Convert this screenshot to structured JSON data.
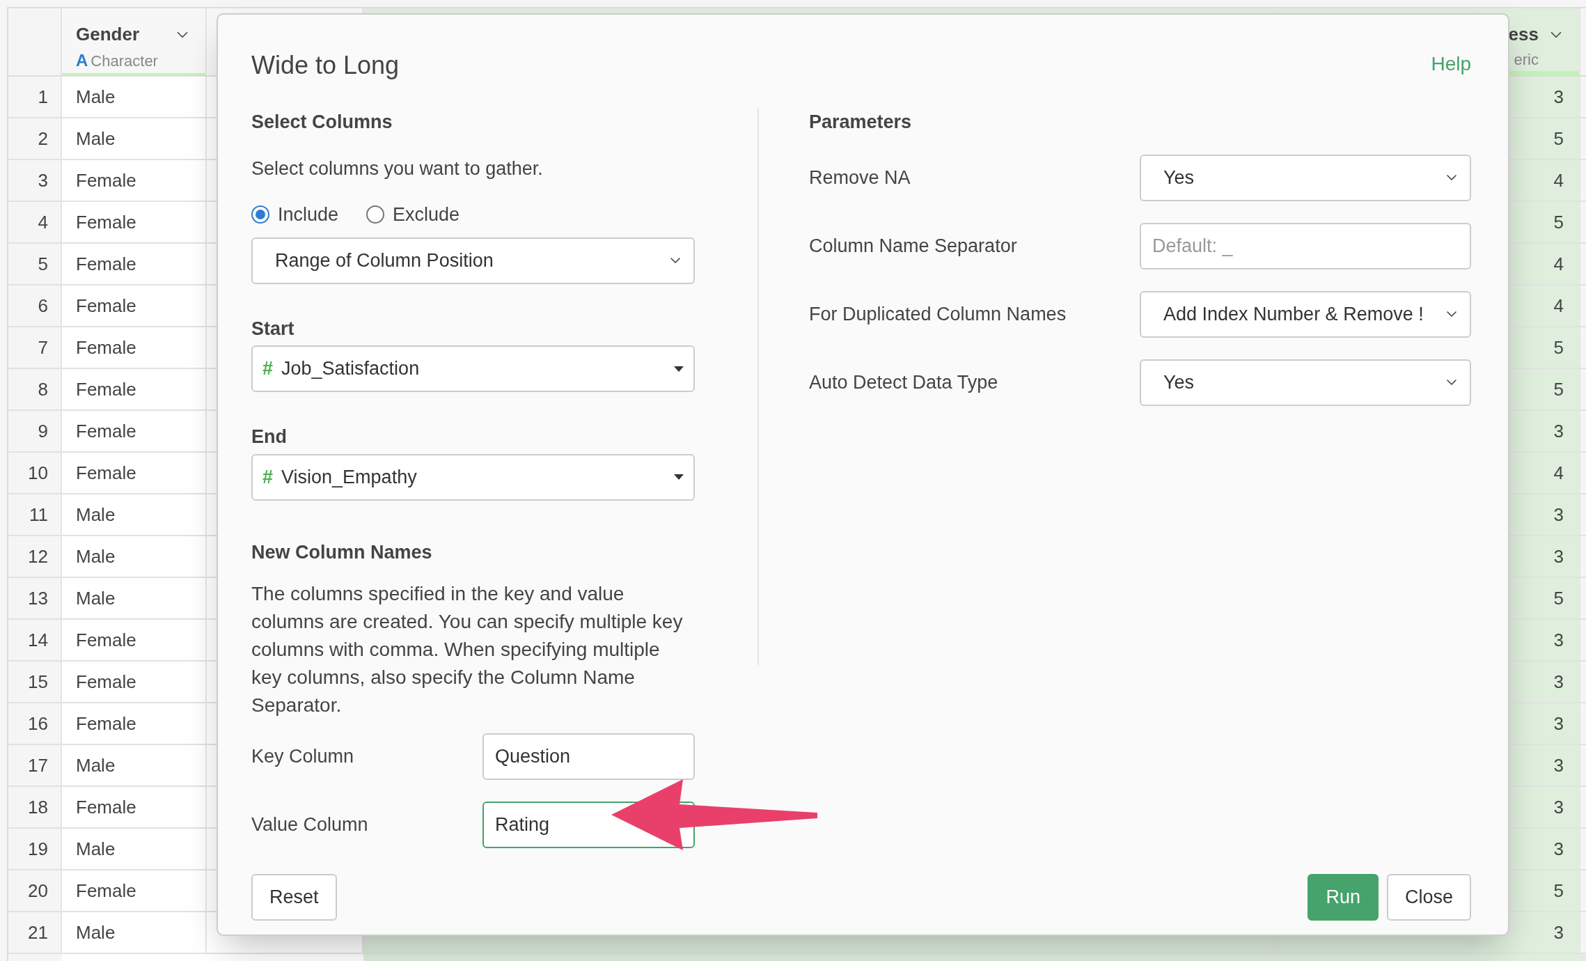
{
  "table": {
    "columns": [
      {
        "name": "Gender",
        "type_icon": "A",
        "type": "Character"
      },
      {
        "name": "ess",
        "type": "eric"
      }
    ],
    "rows": [
      {
        "index": "1",
        "gender": "Male",
        "last": "3"
      },
      {
        "index": "2",
        "gender": "Male",
        "last": "5"
      },
      {
        "index": "3",
        "gender": "Female",
        "last": "4"
      },
      {
        "index": "4",
        "gender": "Female",
        "last": "5"
      },
      {
        "index": "5",
        "gender": "Female",
        "last": "4"
      },
      {
        "index": "6",
        "gender": "Female",
        "last": "4"
      },
      {
        "index": "7",
        "gender": "Female",
        "last": "5"
      },
      {
        "index": "8",
        "gender": "Female",
        "last": "5"
      },
      {
        "index": "9",
        "gender": "Female",
        "last": "3"
      },
      {
        "index": "10",
        "gender": "Female",
        "last": "4"
      },
      {
        "index": "11",
        "gender": "Male",
        "last": "3"
      },
      {
        "index": "12",
        "gender": "Male",
        "last": "3"
      },
      {
        "index": "13",
        "gender": "Male",
        "last": "5"
      },
      {
        "index": "14",
        "gender": "Female",
        "last": "3"
      },
      {
        "index": "15",
        "gender": "Female",
        "last": "3"
      },
      {
        "index": "16",
        "gender": "Female",
        "last": "3"
      },
      {
        "index": "17",
        "gender": "Male",
        "last": "3"
      },
      {
        "index": "18",
        "gender": "Female",
        "last": "3"
      },
      {
        "index": "19",
        "gender": "Male",
        "last": "3"
      },
      {
        "index": "20",
        "gender": "Female",
        "last": "5"
      },
      {
        "index": "21",
        "gender": "Male",
        "last": "3"
      }
    ]
  },
  "dialog": {
    "title": "Wide to Long",
    "help": "Help",
    "select_columns": {
      "heading": "Select Columns",
      "description": "Select columns you want to gather.",
      "modes": [
        {
          "label": "Include",
          "selected": true
        },
        {
          "label": "Exclude",
          "selected": false
        }
      ],
      "method": "Range of Column Position",
      "start": {
        "label": "Start",
        "type_icon": "#",
        "value": "Job_Satisfaction"
      },
      "end": {
        "label": "End",
        "type_icon": "#",
        "value": "Vision_Empathy"
      }
    },
    "new_column_names": {
      "heading": "New Column Names",
      "description": "The columns specified in the key and value columns are created. You can specify multiple key columns with comma. When specifying multiple key columns, also specify the Column Name Separator.",
      "fields": [
        {
          "label": "Key Column",
          "value": "Question",
          "focused": false
        },
        {
          "label": "Value Column",
          "value": "Rating",
          "focused": true
        }
      ]
    },
    "parameters": {
      "heading": "Parameters",
      "rows": [
        {
          "label": "Remove NA",
          "kind": "select",
          "value": "Yes"
        },
        {
          "label": "Column Name Separator",
          "kind": "input",
          "placeholder": "Default: _"
        },
        {
          "label": "For Duplicated Column Names",
          "kind": "select",
          "value": "Add Index Number & Remove !"
        },
        {
          "label": "Auto Detect Data Type",
          "kind": "select",
          "value": "Yes"
        }
      ]
    },
    "buttons": [
      {
        "label": "Reset",
        "kind": "default"
      },
      {
        "label": "Run",
        "kind": "primary"
      },
      {
        "label": "Close",
        "kind": "default"
      }
    ]
  }
}
